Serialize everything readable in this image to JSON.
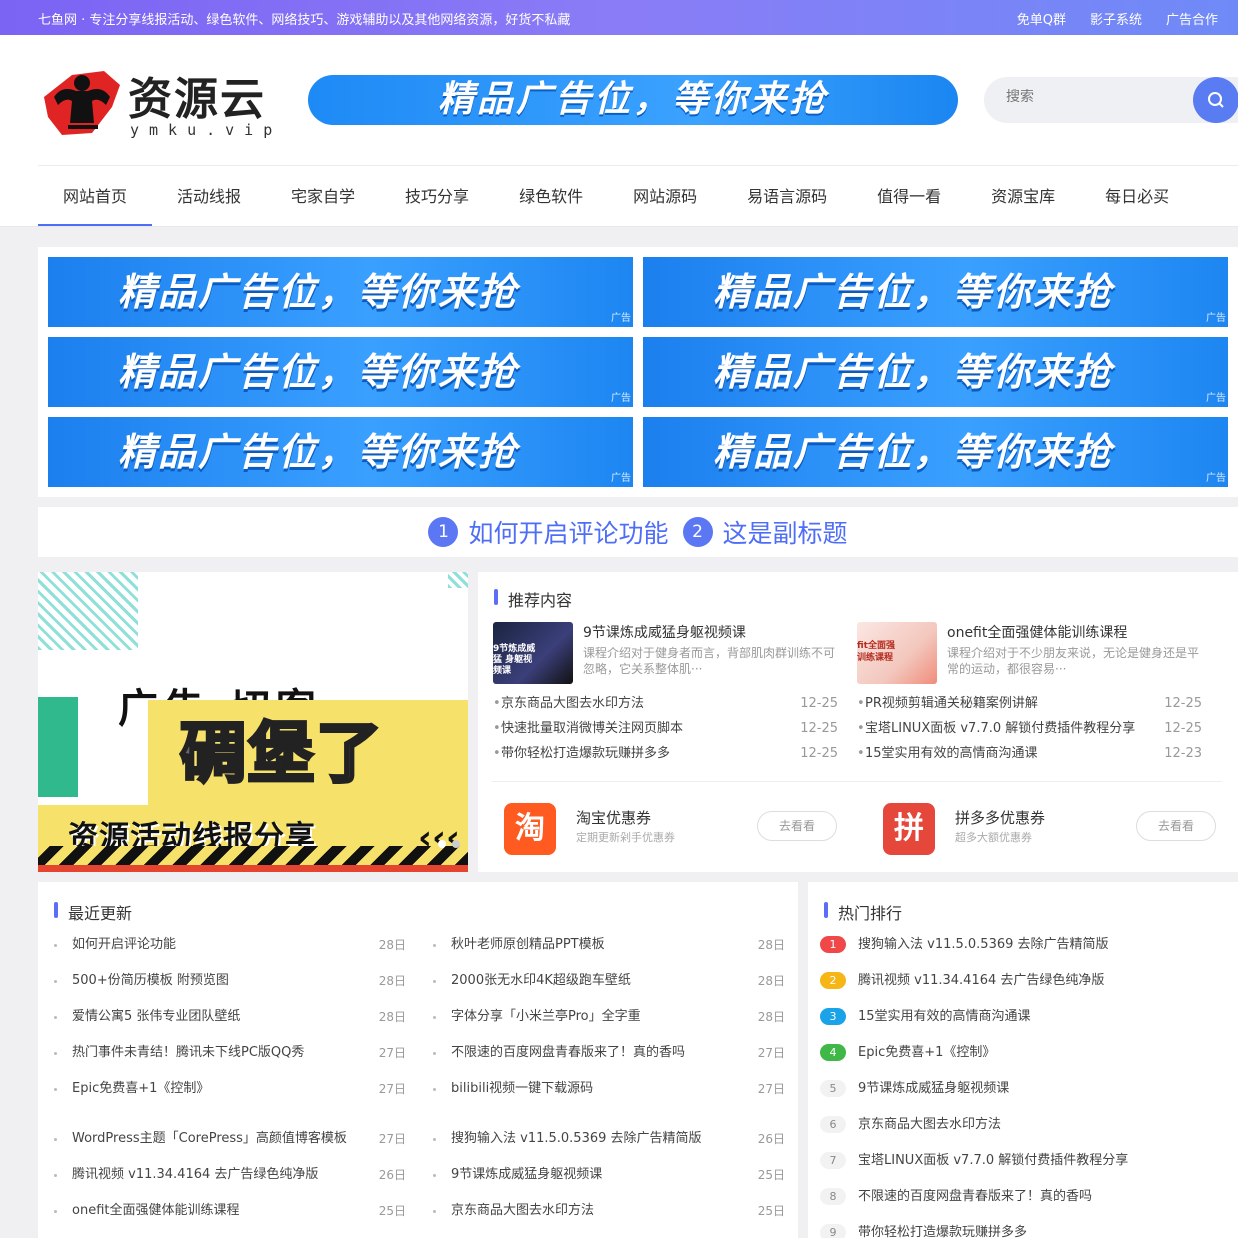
{
  "topbar": {
    "slogan": "七鱼网 · 专注分享线报活动、绿色软件、网络技巧、游戏辅助以及其他网络资源，好货不私藏",
    "links": [
      "免单Q群",
      "影子系统",
      "广告合作"
    ]
  },
  "logo": {
    "cn": "资源云",
    "en": "ymku.vip"
  },
  "header_ad": "精品广告位，等你来抢",
  "search": {
    "placeholder": "搜索"
  },
  "nav": [
    "网站首页",
    "活动线报",
    "宅家自学",
    "技巧分享",
    "绿色软件",
    "网站源码",
    "易语言源码",
    "值得一看",
    "资源宝库",
    "每日必买"
  ],
  "ads": [
    {
      "text": "精品广告位，等你来抢",
      "tag": "广告"
    },
    {
      "text": "精品广告位，等你来抢",
      "tag": "广告"
    },
    {
      "text": "精品广告位，等你来抢",
      "tag": "广告"
    },
    {
      "text": "精品广告位，等你来抢",
      "tag": "广告"
    },
    {
      "text": "精品广告位，等你来抢",
      "tag": "广告"
    },
    {
      "text": "精品广告位，等你来抢",
      "tag": "广告"
    }
  ],
  "subtitles": [
    {
      "num": "1",
      "text": "如何开启评论功能"
    },
    {
      "num": "2",
      "text": "这是副标题"
    }
  ],
  "slider": {
    "big_text": "碉堡了",
    "band_title": "资源活动线报分享",
    "top_text": "广告 切客"
  },
  "recommend": {
    "title": "推荐内容",
    "cards": [
      {
        "title": "9节课炼成威猛身躯视频课",
        "desc": "课程介绍对于健身者而言，背部肌肉群训练不可忽略，它关系整体肌···",
        "thumb_text": "9节炼成威猛 身躯视频课"
      },
      {
        "title": "onefit全面强健体能训练课程",
        "desc": "课程介绍对于不少朋友来说，无论是健身还是平常的运动，都很容易···",
        "thumb_text": "fit全面强 训练课程"
      }
    ],
    "left_list": [
      {
        "title": "京东商品大图去水印方法",
        "date": "12-25"
      },
      {
        "title": "快速批量取消微博关注网页脚本",
        "date": "12-25"
      },
      {
        "title": "带你轻松打造爆款玩赚拼多多",
        "date": "12-25"
      }
    ],
    "right_list": [
      {
        "title": "PR视频剪辑通关秘籍案例讲解",
        "date": "12-25"
      },
      {
        "title": "宝塔LINUX面板 v7.7.0 解锁付费插件教程分享",
        "date": "12-25"
      },
      {
        "title": "15堂实用有效的高情商沟通课",
        "date": "12-23"
      }
    ],
    "coupons": [
      {
        "icon": "淘",
        "name": "淘宝优惠券",
        "sub": "定期更新剁手优惠券",
        "go": "去看看",
        "color": "#ff5a1f"
      },
      {
        "icon": "拼",
        "name": "拼多多优惠券",
        "sub": "超多大额优惠券",
        "go": "去看看",
        "color": "#e5473a"
      }
    ]
  },
  "latest": {
    "title": "最近更新",
    "left": [
      {
        "title": "如何开启评论功能",
        "date": "28日"
      },
      {
        "title": "500+份简历模板 附预览图",
        "date": "28日"
      },
      {
        "title": "爱情公寓5 张伟专业团队壁纸",
        "date": "28日"
      },
      {
        "title": "热门事件未青结！腾讯未下线PC版QQ秀",
        "date": "27日"
      },
      {
        "title": "Epic免费喜+1《控制》",
        "date": "27日"
      },
      {
        "title": "WordPress主题「CorePress」高颜值博客模板",
        "date": "27日"
      },
      {
        "title": "腾讯视频 v11.34.4164 去广告绿色纯净版",
        "date": "26日"
      },
      {
        "title": "onefit全面强健体能训练课程",
        "date": "25日"
      }
    ],
    "right": [
      {
        "title": "秋叶老师原创精品PPT模板",
        "date": "28日"
      },
      {
        "title": "2000张无水印4K超级跑车壁纸",
        "date": "28日"
      },
      {
        "title": "字体分享「小米兰亭Pro」全字重",
        "date": "28日"
      },
      {
        "title": "不限速的百度网盘青春版来了！真的香吗",
        "date": "27日"
      },
      {
        "title": "bilibili视频一键下载源码",
        "date": "27日"
      },
      {
        "title": "搜狗输入法 v11.5.0.5369 去除广告精简版",
        "date": "26日"
      },
      {
        "title": "9节课炼成威猛身躯视频课",
        "date": "25日"
      },
      {
        "title": "京东商品大图去水印方法",
        "date": "25日"
      }
    ]
  },
  "hot": {
    "title": "热门排行",
    "items": [
      {
        "rank": "1",
        "title": "搜狗输入法 v11.5.0.5369 去除广告精简版",
        "color": "#f04848"
      },
      {
        "rank": "2",
        "title": "腾讯视频 v11.34.4164 去广告绿色纯净版",
        "color": "#f5b616"
      },
      {
        "rank": "3",
        "title": "15堂实用有效的高情商沟通课",
        "color": "#1aa3e8"
      },
      {
        "rank": "4",
        "title": "Epic免费喜+1《控制》",
        "color": "#3fb848"
      },
      {
        "rank": "5",
        "title": "9节课炼成威猛身躯视频课",
        "color": ""
      },
      {
        "rank": "6",
        "title": "京东商品大图去水印方法",
        "color": ""
      },
      {
        "rank": "7",
        "title": "宝塔LINUX面板 v7.7.0 解锁付费插件教程分享",
        "color": ""
      },
      {
        "rank": "8",
        "title": "不限速的百度网盘青春版来了！真的香吗",
        "color": ""
      },
      {
        "rank": "9",
        "title": "带你轻松打造爆款玩赚拼多多",
        "color": ""
      }
    ]
  }
}
